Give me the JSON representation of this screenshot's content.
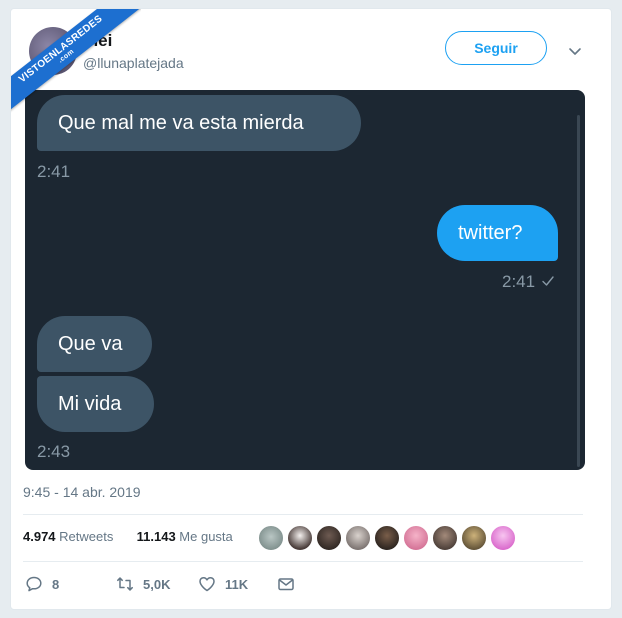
{
  "branding": {
    "ribbon_text": "VISTOENLASREDES",
    "ribbon_sub": ".com"
  },
  "tweet": {
    "author": {
      "display_name": "mei",
      "handle": "@llunaplatejada"
    },
    "follow_label": "Seguir",
    "timestamp": "9:45 - 14 abr. 2019"
  },
  "chat": {
    "messages": [
      {
        "text": "Que mal me va esta mierda",
        "side": "received"
      },
      {
        "time": "2:41"
      },
      {
        "text": "twitter?",
        "side": "sent"
      },
      {
        "time": "2:41",
        "read_check": true
      },
      {
        "text": "Que va",
        "side": "received"
      },
      {
        "text": "Mi vida",
        "side": "received"
      },
      {
        "time": "2:43"
      }
    ]
  },
  "stats": {
    "retweets_count": "4.974",
    "retweets_label": "Retweets",
    "likes_count": "11.143",
    "likes_label": "Me gusta"
  },
  "actions": {
    "reply_count": "8",
    "retweet_count": "5,0K",
    "like_count": "11K"
  },
  "colors": {
    "accent": "#1da1f2",
    "chat_background": "#1c2732",
    "received_bubble": "#3d5466",
    "sent_bubble": "#1da1f2"
  },
  "icons": [
    "reply-icon",
    "retweet-icon",
    "like-icon",
    "message-icon",
    "chevron-down-icon",
    "check-icon"
  ]
}
